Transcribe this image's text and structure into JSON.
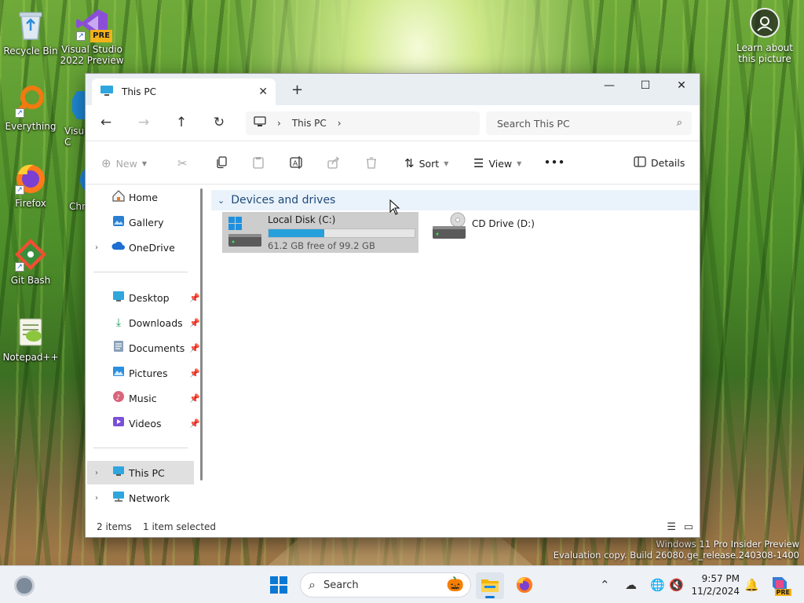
{
  "desktop": {
    "icons": [
      {
        "label": "Recycle Bin"
      },
      {
        "label": "Visual Studio 2022 Preview",
        "badge": "PRE"
      },
      {
        "label": "Everything"
      },
      {
        "label": "Visua C"
      },
      {
        "label": "Firefox"
      },
      {
        "label": "Chr"
      },
      {
        "label": "Git Bash"
      },
      {
        "label": "Notepad++"
      }
    ],
    "learn_label": "Learn about this picture",
    "watermark_line1": "Windows 11 Pro Insider Preview",
    "watermark_line2": "Evaluation copy. Build 26080.ge_release.240308-1400"
  },
  "window": {
    "tab_title": "This PC",
    "breadcrumb": "This PC",
    "search_placeholder": "Search This PC",
    "commands": {
      "new": "New",
      "sort": "Sort",
      "view": "View",
      "more": "•••",
      "details": "Details"
    },
    "sidebar": {
      "items": [
        {
          "label": "Home"
        },
        {
          "label": "Gallery"
        },
        {
          "label": "OneDrive"
        },
        {
          "label": "Desktop"
        },
        {
          "label": "Downloads"
        },
        {
          "label": "Documents"
        },
        {
          "label": "Pictures"
        },
        {
          "label": "Music"
        },
        {
          "label": "Videos"
        },
        {
          "label": "This PC"
        },
        {
          "label": "Network"
        }
      ]
    },
    "group_header": "Devices and drives",
    "drives": [
      {
        "name": "Local Disk (C:)",
        "free_text": "61.2 GB free of 99.2 GB",
        "used_fraction": 0.383
      },
      {
        "name": "CD Drive (D:)"
      }
    ],
    "status": {
      "items": "2 items",
      "selected": "1 item selected"
    }
  },
  "taskbar": {
    "search_label": "Search",
    "time": "9:57 PM",
    "date": "11/2/2024",
    "copilot_badge": "PRE"
  },
  "colors": {
    "accent": "#0a78d4",
    "progress_fill": "#26a0da",
    "selection": "#cdcdcd",
    "group_header_bg": "#eaf3fb"
  }
}
